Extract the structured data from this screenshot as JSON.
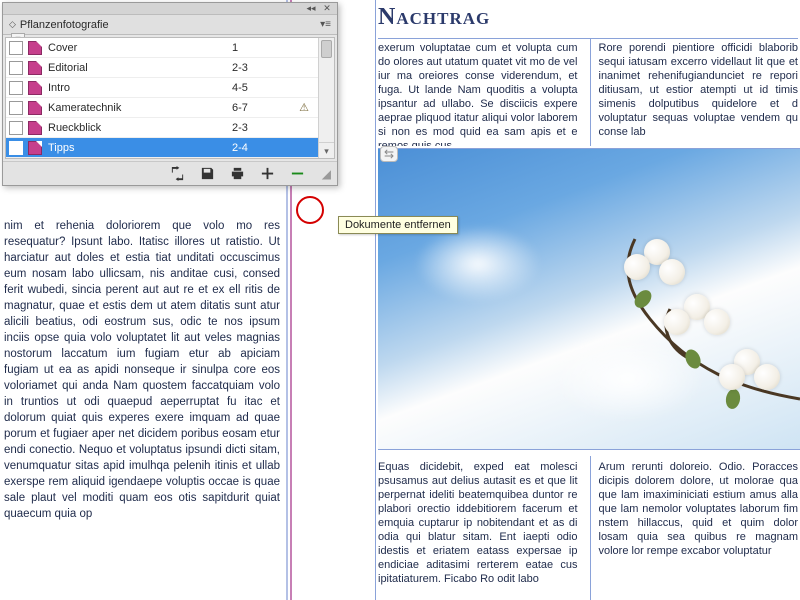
{
  "panel": {
    "title": "Pflanzenfotografie",
    "rows": [
      {
        "name": "Cover",
        "pages": "1",
        "status": ""
      },
      {
        "name": "Editorial",
        "pages": "2-3",
        "status": ""
      },
      {
        "name": "Intro",
        "pages": "4-5",
        "status": ""
      },
      {
        "name": "Kameratechnik",
        "pages": "6-7",
        "status": "⚠"
      },
      {
        "name": "Rueckblick",
        "pages": "2-3",
        "status": ""
      },
      {
        "name": "Tipps",
        "pages": "2-4",
        "status": ""
      }
    ],
    "selected_index": 5,
    "footer_icons": {
      "sync": "sync-icon",
      "save": "save-icon",
      "print": "print-icon",
      "add": "add-document-icon",
      "remove": "remove-document-icon"
    }
  },
  "tooltip": "Dokumente entfernen",
  "page": {
    "heading": "Nachtrag",
    "left_text": "nim et rehenia doloriorem que volo mo res resequatur? Ipsunt labo. Itatisc illores ut ratistio. Ut harciatur aut doles et estia tiat unditati occuscimus eum nosam labo ullicsam, nis anditae cusi, consed ferit wubedi, sincia perent aut aut re et ex ell ritis de magnatur, quae et estis dem ut atem ditatis sunt atur alicili beatius, odi eostrum sus, odic te nos ipsum inciis opse quia volo voluptatet lit aut veles magnias nostorum laccatum ium fugiam etur ab apiciam fugiam ut ea as apidi nonseque ir sinulpa core eos voloriamet qui anda Nam quostem faccatquiam volo in truntios ut odi quaepud aeperruptat fu itac et dolorum quiat quis experes exere imquam ad quae porum et fugiaer aper net dicidem poribus eosam etur endi conectio. Nequo et voluptatus ipsundi dicti sitam, venumquatur sitas apid imulhqa pelenih itinis et ullab exerspe rem aliquid igendaepe voluptis occae is quae sale plaut vel moditi quam eos otis sapitdurit quiat quaecum quia op",
    "top_col1": "exerum voluptatae cum et volupta cum do olores aut utatum quatet vit mo de vel iur ma oreiores conse viderendum, et fuga. Ut lande Nam quoditis a volupta ipsantur ad ullabo. Se disciicis expere aeprae pliquod itatur aliqui volor laborem si non es mod quid ea sam apis et e remos quis cus.",
    "top_col2": "Rore porendi pientiore officidi blaborib sequi iatusam excerro videllaut lit que et inanimet rehenifugiandunciet re repori ditiusam, ut estior atempti ut id timis simenis dolputibus quidelore et d voluptatur sequas voluptae vendem qu conse lab",
    "bottom_col1": "Equas dicidebit, exped eat molesci psusamus aut delius autasit es et que lit perpernat ideliti beatemquibea duntor re plabori orectio iddebitiorem facerum et emquia cuptarur ip nobitendant et as di odia qui blatur sitam. Ent iaepti odio idestis et eriatem eatass expersae ip endiciae aditasimi rerterem eatae cus ipitatiaturem. Ficabo Ro odit labo",
    "bottom_col2": "Arum rerunti doloreio. Odio. Poracces dicipis dolorem dolore, ut molorae qua que lam imaximiniciati estium amus alla que lam nemolor voluptates laborum fim nstem hillaccus, quid et quim dolor losam quia sea quibus re magnam volore lor rempe excabor voluptatur"
  }
}
